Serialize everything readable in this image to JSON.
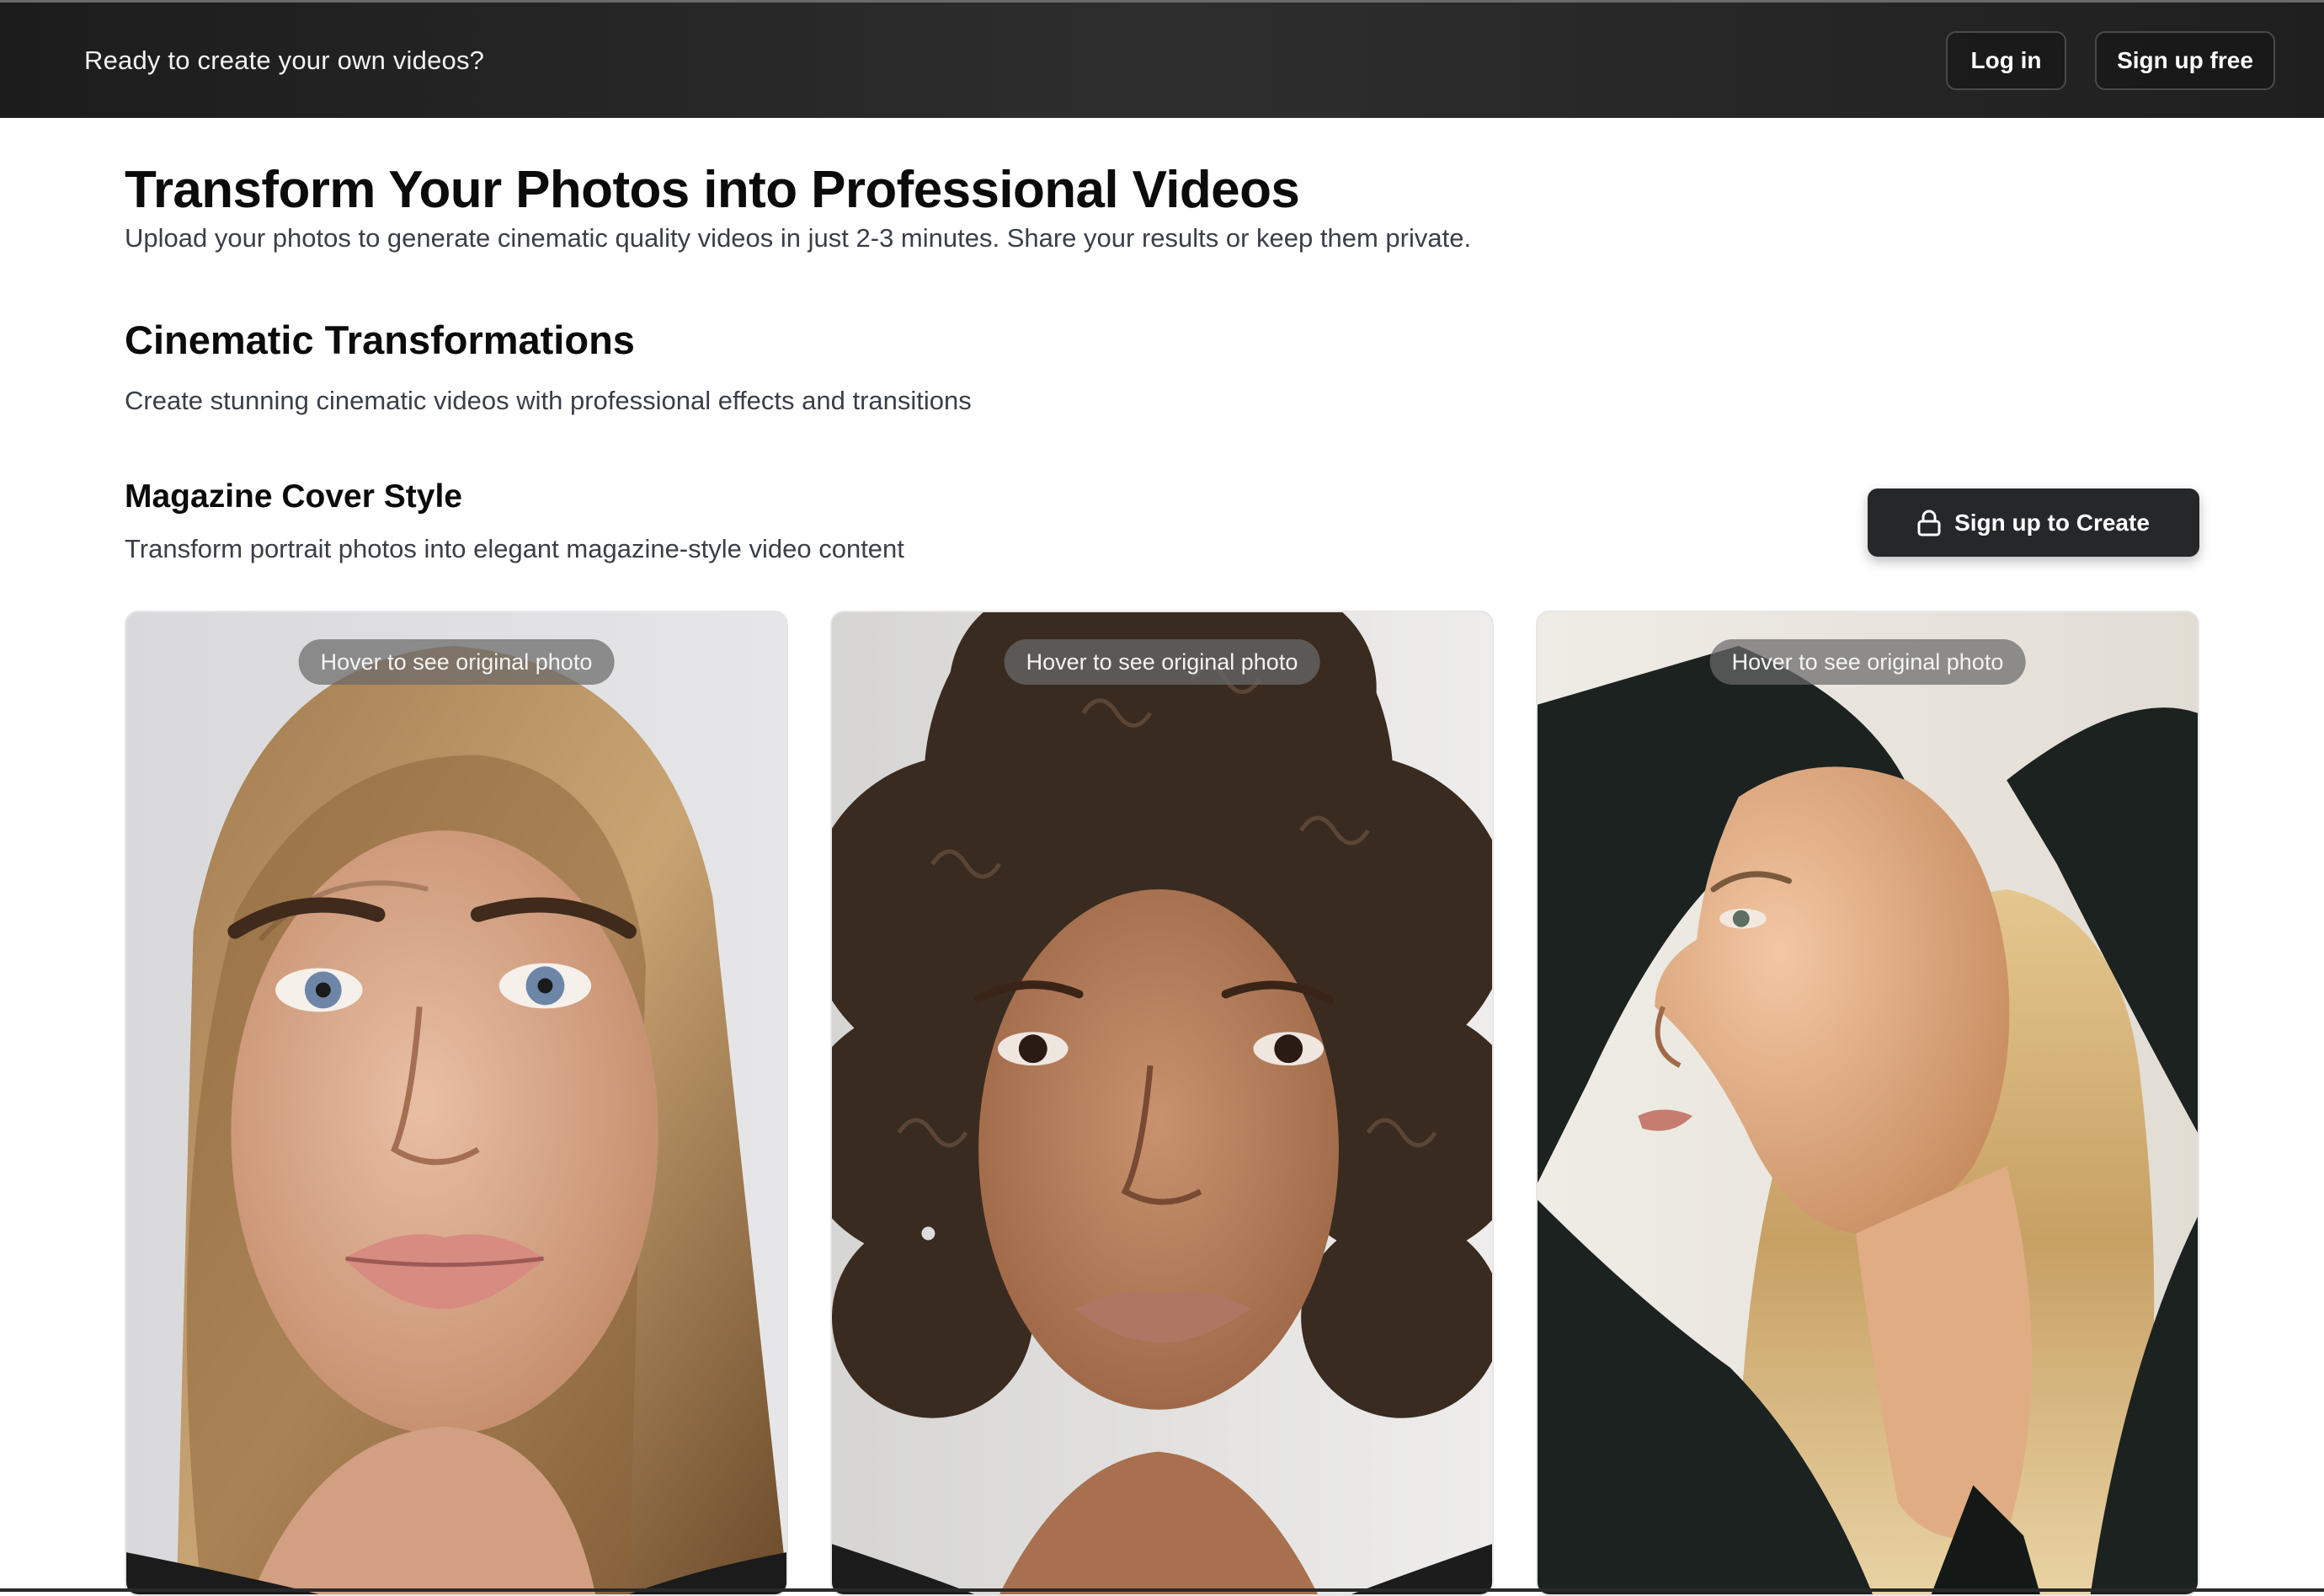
{
  "banner": {
    "text": "Ready to create your own videos?",
    "login_label": "Log in",
    "signup_label": "Sign up free"
  },
  "header": {
    "title": "Transform Your Photos into Professional Videos",
    "subtitle": "Upload your photos to generate cinematic quality videos in just 2-3 minutes. Share your results or keep them private."
  },
  "section": {
    "title": "Cinematic Transformations",
    "description": "Create stunning cinematic videos with professional effects and transitions"
  },
  "style": {
    "title": "Magazine Cover Style",
    "description": "Transform portrait photos into elegant magazine-style video content",
    "cta_label": "Sign up to Create",
    "cta_icon": "lock-icon"
  },
  "cards": [
    {
      "hover_label": "Hover to see original photo"
    },
    {
      "hover_label": "Hover to see original photo"
    },
    {
      "hover_label": "Hover to see original photo"
    }
  ],
  "colors": {
    "banner_bg": "#242424",
    "cta_bg": "#262729",
    "text_primary": "#0b0b0b",
    "text_secondary": "#3a3f47"
  }
}
